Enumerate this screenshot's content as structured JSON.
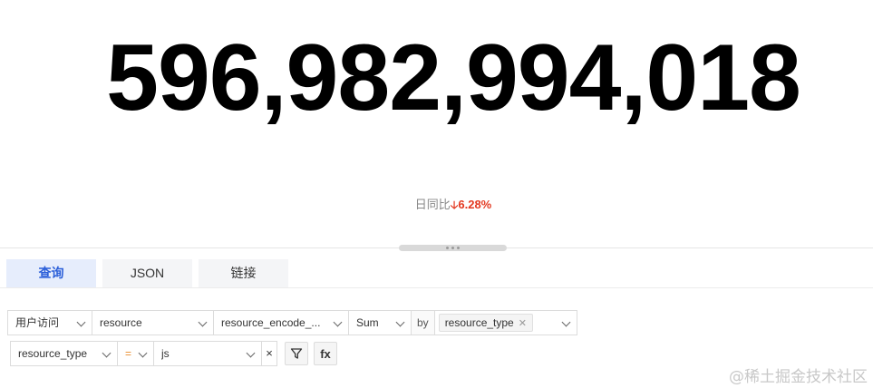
{
  "metric": {
    "value": "596,982,994,018",
    "compare_label": "日同比",
    "compare_arrow": "🡣",
    "compare_value": "6.28%",
    "compare_color": "#e33a22"
  },
  "tabs": [
    {
      "label": "查询",
      "active": true
    },
    {
      "label": "JSON",
      "active": false
    },
    {
      "label": "链接",
      "active": false
    }
  ],
  "query": {
    "source": "用户访问",
    "measure": "resource",
    "field": "resource_encode_...",
    "aggregation": "Sum",
    "by_label": "by",
    "group_by_tags": [
      "resource_type"
    ]
  },
  "filter": {
    "field": "resource_type",
    "operator": "=",
    "value": "js",
    "clear_label": "×",
    "fx_label": "fx"
  },
  "watermark": "@稀土掘金技术社区",
  "colors": {
    "accent": "#2b5fd9",
    "decrease": "#e33a22",
    "operator": "#e98b2a"
  }
}
